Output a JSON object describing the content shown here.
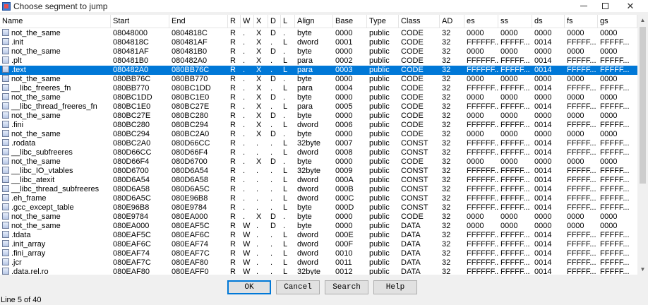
{
  "window": {
    "title": "Choose segment to jump"
  },
  "columns": [
    "Name",
    "Start",
    "End",
    "R",
    "W",
    "X",
    "D",
    "L",
    "Align",
    "Base",
    "Type",
    "Class",
    "AD",
    "es",
    "ss",
    "ds",
    "fs",
    "gs"
  ],
  "selected_row": 4,
  "rows": [
    [
      "not_the_same",
      "08048000",
      "0804818C",
      "R",
      ".",
      "X",
      "D",
      ".",
      "byte",
      "0000",
      "public",
      "CODE",
      "32",
      "0000",
      "0000",
      "0000",
      "0000",
      "0000"
    ],
    [
      ".init",
      "0804818C",
      "080481AF",
      "R",
      ".",
      "X",
      ".",
      "L",
      "dword",
      "0001",
      "public",
      "CODE",
      "32",
      "FFFFFF...",
      "FFFFF...",
      "0014",
      "FFFFF...",
      "FFFFF..."
    ],
    [
      "not_the_same",
      "080481AF",
      "080481B0",
      "R",
      ".",
      "X",
      "D",
      ".",
      "byte",
      "0000",
      "public",
      "CODE",
      "32",
      "0000",
      "0000",
      "0000",
      "0000",
      "0000"
    ],
    [
      ".plt",
      "080481B0",
      "080482A0",
      "R",
      ".",
      "X",
      ".",
      "L",
      "para",
      "0002",
      "public",
      "CODE",
      "32",
      "FFFFFF...",
      "FFFFF...",
      "0014",
      "FFFFF...",
      "FFFFF..."
    ],
    [
      ".text",
      "080482A0",
      "080BB76C",
      "R",
      ".",
      "X",
      ".",
      "L",
      "para",
      "0003",
      "public",
      "CODE",
      "32",
      "FFFFFF...",
      "FFFFF...",
      "0014",
      "FFFFF...",
      "FFFFF..."
    ],
    [
      "not_the_same",
      "080BB76C",
      "080BB770",
      "R",
      ".",
      "X",
      "D",
      ".",
      "byte",
      "0000",
      "public",
      "CODE",
      "32",
      "0000",
      "0000",
      "0000",
      "0000",
      "0000"
    ],
    [
      "__libc_freeres_fn",
      "080BB770",
      "080BC1DD",
      "R",
      ".",
      "X",
      ".",
      "L",
      "para",
      "0004",
      "public",
      "CODE",
      "32",
      "FFFFFF...",
      "FFFFF...",
      "0014",
      "FFFFF...",
      "FFFFF..."
    ],
    [
      "not_the_same",
      "080BC1DD",
      "080BC1E0",
      "R",
      ".",
      "X",
      "D",
      ".",
      "byte",
      "0000",
      "public",
      "CODE",
      "32",
      "0000",
      "0000",
      "0000",
      "0000",
      "0000"
    ],
    [
      "__libc_thread_freeres_fn",
      "080BC1E0",
      "080BC27E",
      "R",
      ".",
      "X",
      ".",
      "L",
      "para",
      "0005",
      "public",
      "CODE",
      "32",
      "FFFFFF...",
      "FFFFF...",
      "0014",
      "FFFFF...",
      "FFFFF..."
    ],
    [
      "not_the_same",
      "080BC27E",
      "080BC280",
      "R",
      ".",
      "X",
      "D",
      ".",
      "byte",
      "0000",
      "public",
      "CODE",
      "32",
      "0000",
      "0000",
      "0000",
      "0000",
      "0000"
    ],
    [
      ".fini",
      "080BC280",
      "080BC294",
      "R",
      ".",
      "X",
      ".",
      "L",
      "dword",
      "0006",
      "public",
      "CODE",
      "32",
      "FFFFFF...",
      "FFFFF...",
      "0014",
      "FFFFF...",
      "FFFFF..."
    ],
    [
      "not_the_same",
      "080BC294",
      "080BC2A0",
      "R",
      ".",
      "X",
      "D",
      ".",
      "byte",
      "0000",
      "public",
      "CODE",
      "32",
      "0000",
      "0000",
      "0000",
      "0000",
      "0000"
    ],
    [
      ".rodata",
      "080BC2A0",
      "080D66CC",
      "R",
      ".",
      ".",
      ".",
      "L",
      "32byte",
      "0007",
      "public",
      "CONST",
      "32",
      "FFFFFF...",
      "FFFFF...",
      "0014",
      "FFFFF...",
      "FFFFF..."
    ],
    [
      "__libc_subfreeres",
      "080D66CC",
      "080D66F4",
      "R",
      ".",
      ".",
      ".",
      "L",
      "dword",
      "0008",
      "public",
      "CONST",
      "32",
      "FFFFFF...",
      "FFFFF...",
      "0014",
      "FFFFF...",
      "FFFFF..."
    ],
    [
      "not_the_same",
      "080D66F4",
      "080D6700",
      "R",
      ".",
      "X",
      "D",
      ".",
      "byte",
      "0000",
      "public",
      "CODE",
      "32",
      "0000",
      "0000",
      "0000",
      "0000",
      "0000"
    ],
    [
      "__libc_IO_vtables",
      "080D6700",
      "080D6A54",
      "R",
      ".",
      ".",
      ".",
      "L",
      "32byte",
      "0009",
      "public",
      "CONST",
      "32",
      "FFFFFF...",
      "FFFFF...",
      "0014",
      "FFFFF...",
      "FFFFF..."
    ],
    [
      "__libc_atexit",
      "080D6A54",
      "080D6A58",
      "R",
      ".",
      ".",
      ".",
      "L",
      "dword",
      "000A",
      "public",
      "CONST",
      "32",
      "FFFFFF...",
      "FFFFF...",
      "0014",
      "FFFFF...",
      "FFFFF..."
    ],
    [
      "__libc_thread_subfreeres",
      "080D6A58",
      "080D6A5C",
      "R",
      ".",
      ".",
      ".",
      "L",
      "dword",
      "000B",
      "public",
      "CONST",
      "32",
      "FFFFFF...",
      "FFFFF...",
      "0014",
      "FFFFF...",
      "FFFFF..."
    ],
    [
      ".eh_frame",
      "080D6A5C",
      "080E96B8",
      "R",
      ".",
      ".",
      ".",
      "L",
      "dword",
      "000C",
      "public",
      "CONST",
      "32",
      "FFFFFF...",
      "FFFFF...",
      "0014",
      "FFFFF...",
      "FFFFF..."
    ],
    [
      ".gcc_except_table",
      "080E96B8",
      "080E9784",
      "R",
      ".",
      ".",
      ".",
      "L",
      "byte",
      "000D",
      "public",
      "CONST",
      "32",
      "FFFFFF...",
      "FFFFF...",
      "0014",
      "FFFFF...",
      "FFFFF..."
    ],
    [
      "not_the_same",
      "080E9784",
      "080EA000",
      "R",
      ".",
      "X",
      "D",
      ".",
      "byte",
      "0000",
      "public",
      "CODE",
      "32",
      "0000",
      "0000",
      "0000",
      "0000",
      "0000"
    ],
    [
      "not_the_same",
      "080EA000",
      "080EAF5C",
      "R",
      "W",
      ".",
      "D",
      ".",
      "byte",
      "0000",
      "public",
      "DATA",
      "32",
      "0000",
      "0000",
      "0000",
      "0000",
      "0000"
    ],
    [
      ".tdata",
      "080EAF5C",
      "080EAF6C",
      "R",
      "W",
      ".",
      ".",
      "L",
      "dword",
      "000E",
      "public",
      "DATA",
      "32",
      "FFFFFF...",
      "FFFFF...",
      "0014",
      "FFFFF...",
      "FFFFF..."
    ],
    [
      ".init_array",
      "080EAF6C",
      "080EAF74",
      "R",
      "W",
      ".",
      ".",
      "L",
      "dword",
      "000F",
      "public",
      "DATA",
      "32",
      "FFFFFF...",
      "FFFFF...",
      "0014",
      "FFFFF...",
      "FFFFF..."
    ],
    [
      ".fini_array",
      "080EAF74",
      "080EAF7C",
      "R",
      "W",
      ".",
      ".",
      "L",
      "dword",
      "0010",
      "public",
      "DATA",
      "32",
      "FFFFFF...",
      "FFFFF...",
      "0014",
      "FFFFF...",
      "FFFFF..."
    ],
    [
      ".jcr",
      "080EAF7C",
      "080EAF80",
      "R",
      "W",
      ".",
      ".",
      "L",
      "dword",
      "0011",
      "public",
      "DATA",
      "32",
      "FFFFFF...",
      "FFFFF...",
      "0014",
      "FFFFF...",
      "FFFFF..."
    ],
    [
      ".data.rel.ro",
      "080EAF80",
      "080EAFF0",
      "R",
      "W",
      ".",
      ".",
      "L",
      "32byte",
      "0012",
      "public",
      "DATA",
      "32",
      "FFFFFF...",
      "FFFFF...",
      "0014",
      "FFFFF...",
      "FFFFF..."
    ]
  ],
  "buttons": {
    "ok": "OK",
    "cancel": "Cancel",
    "search": "Search",
    "help": "Help"
  },
  "status": "Line 5 of 40",
  "colors": {
    "selection": "#0078d7",
    "default_button_border": "#0078d7"
  }
}
